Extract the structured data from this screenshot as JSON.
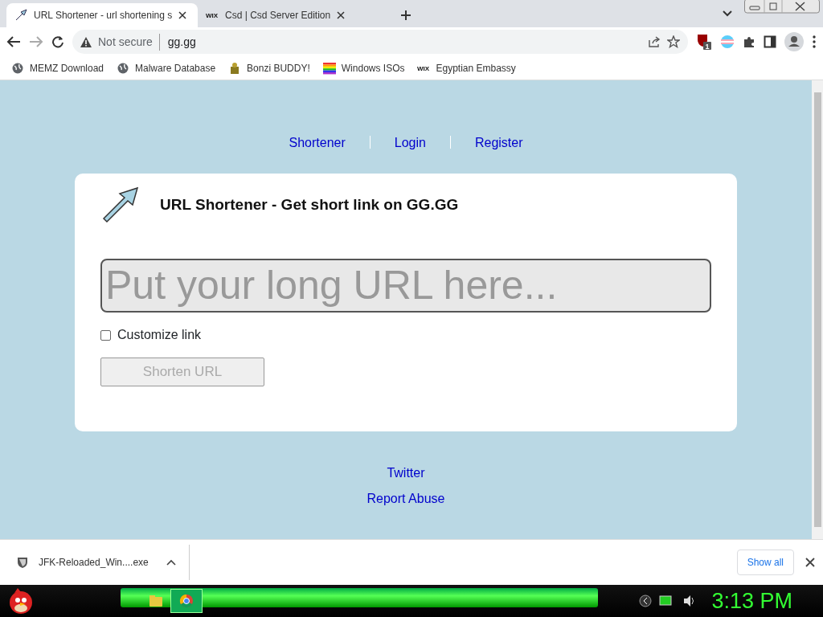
{
  "tabs": [
    {
      "title": "URL Shortener - url shortening s",
      "selected": true,
      "kind": "arrow"
    },
    {
      "title": "Csd | Csd Server Edition",
      "selected": false,
      "kind": "wix",
      "logo": "WIX"
    }
  ],
  "address": {
    "security": "Not secure",
    "url": "gg.gg"
  },
  "extensions": [
    {
      "badge": "1"
    }
  ],
  "bookmarks": [
    {
      "label": "MEMZ Download",
      "kind": "globe"
    },
    {
      "label": "Malware Database",
      "kind": "globe"
    },
    {
      "label": "Bonzi BUDDY!",
      "kind": "figure"
    },
    {
      "label": "Windows ISOs",
      "kind": "rainbow"
    },
    {
      "label": "Egyptian Embassy",
      "kind": "wix",
      "logo": "WIX"
    }
  ],
  "nav": [
    "Shortener",
    "Login",
    "Register"
  ],
  "card": {
    "title": "URL Shortener - Get short link on GG.GG",
    "url_field": {
      "placeholder": "Put your long URL here..."
    },
    "customize": {
      "label": "Customize link",
      "checked": false
    },
    "submit": {
      "label": "Shorten URL",
      "disabled": true
    }
  },
  "footer_links": [
    "Twitter",
    "Report Abuse"
  ],
  "download": {
    "filename": "JFK-Reloaded_Win....exe",
    "show_all": "Show all"
  },
  "taskbar": {
    "clock": "3:13 PM"
  }
}
